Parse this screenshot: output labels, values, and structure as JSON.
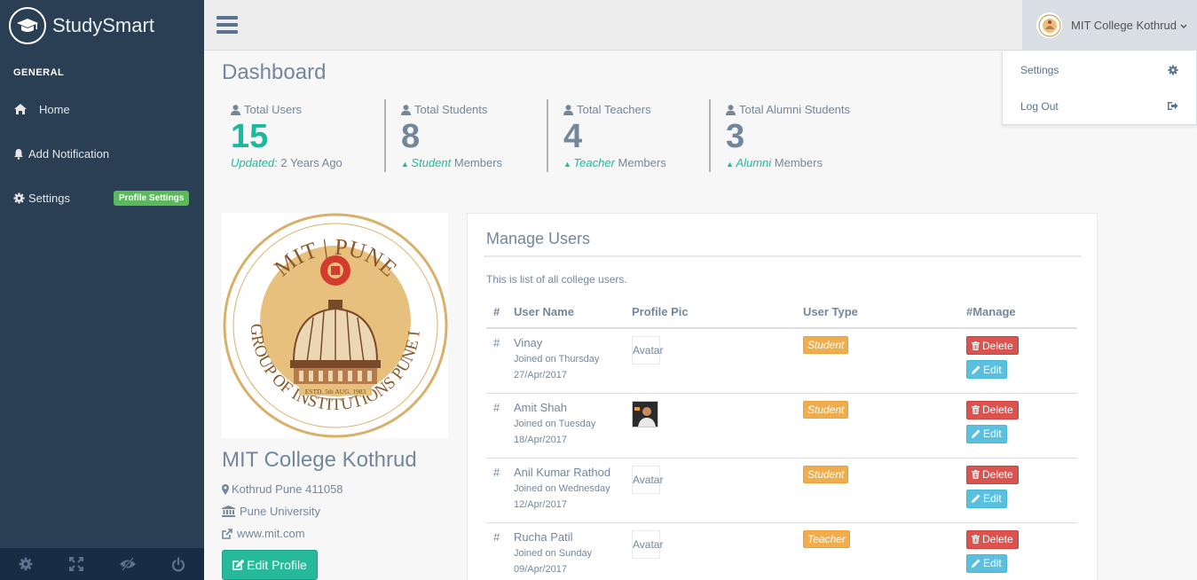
{
  "brand": {
    "name": "StudySmart",
    "icon": "graduation-cap-icon"
  },
  "sidebar": {
    "section": "GENERAL",
    "items": [
      {
        "label": "Home",
        "icon": "home-icon"
      },
      {
        "label": "Add Notification",
        "icon": "bell-icon"
      },
      {
        "label": "Settings",
        "icon": "gear-icon",
        "badge": "Profile Settings"
      }
    ],
    "footer_icons": [
      "gear-icon",
      "fullscreen-icon",
      "eye-slash-icon",
      "power-icon"
    ]
  },
  "topnav": {
    "user_name": "MIT College Kothrud",
    "dropdown": [
      {
        "label": "Settings",
        "icon": "gear-icon"
      },
      {
        "label": "Log Out",
        "icon": "sign-out-icon"
      }
    ]
  },
  "page": {
    "title": "Dashboard"
  },
  "tiles": [
    {
      "label": "Total Users",
      "count": "15",
      "bottom_em": "Updated:",
      "bottom_rest": " 2 Years Ago"
    },
    {
      "label": "Total Students",
      "count": "8",
      "bottom_em": "Student",
      "bottom_rest": " Members"
    },
    {
      "label": "Total Teachers",
      "count": "4",
      "bottom_em": "Teacher",
      "bottom_rest": " Members"
    },
    {
      "label": "Total Alumni Students",
      "count": "3",
      "bottom_em": "Alumni",
      "bottom_rest": " Members"
    }
  ],
  "profile": {
    "logo_text_top": "MIT | PUNE",
    "logo_text_ring": "MIT GROUP OF INSTITUTIONS PUNE INDIA",
    "logo_text_estd": "ESTD. 5th AUG. 1983",
    "name": "MIT College Kothrud",
    "address": "Kothrud Pune 411058",
    "university": "Pune University",
    "website": "www.mit.com",
    "edit_label": "Edit Profile"
  },
  "manage_users": {
    "title": "Manage Users",
    "description": "This is list of all college users.",
    "columns": [
      "#",
      "User Name",
      "Profile Pic",
      "User Type",
      "#Manage"
    ],
    "rows": [
      {
        "num": "#",
        "name": "Vinay",
        "joined_1": "Joined on Thursday",
        "joined_2": "27/Apr/2017",
        "pic": "Avatar",
        "type": "Student"
      },
      {
        "num": "#",
        "name": "Amit Shah",
        "joined_1": "Joined on Tuesday",
        "joined_2": "18/Apr/2017",
        "pic": "",
        "type": "Student"
      },
      {
        "num": "#",
        "name": "Anil Kumar Rathod",
        "joined_1": "Joined on Wednesday",
        "joined_2": "12/Apr/2017",
        "pic": "Avatar",
        "type": "Student"
      },
      {
        "num": "#",
        "name": "Rucha Patil",
        "joined_1": "Joined on Sunday",
        "joined_2": "09/Apr/2017",
        "pic": "Avatar",
        "type": "Teacher"
      }
    ],
    "delete_label": "Delete",
    "edit_label": "Edit"
  }
}
